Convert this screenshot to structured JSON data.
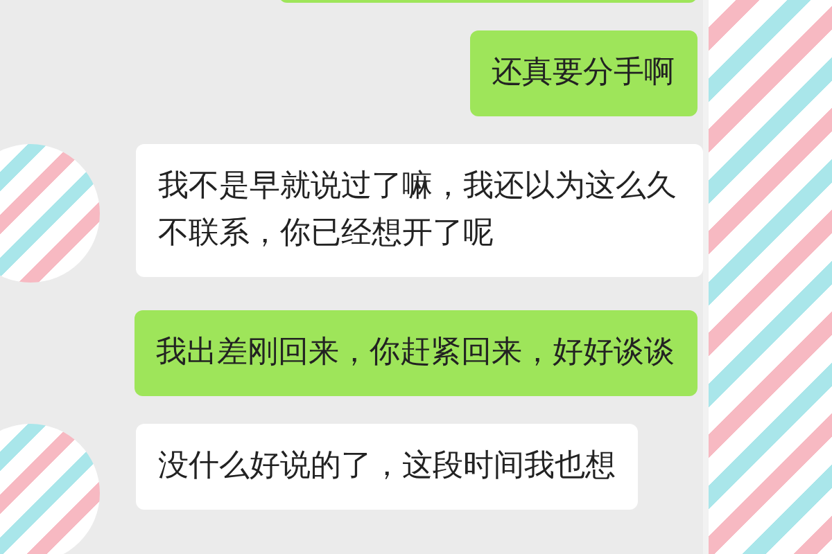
{
  "messages": [
    {
      "kind": "sent"
    },
    {
      "kind": "sent",
      "text": "还真要分手啊"
    },
    {
      "kind": "received",
      "text": "我不是早就说过了嘛，我还以为这么久不联系，你已经想开了呢"
    },
    {
      "kind": "sent",
      "text": "我出差刚回来，你赶紧回来，好好谈谈"
    },
    {
      "kind": "received",
      "text": "没什么好说的了，这段时间我也想"
    }
  ]
}
